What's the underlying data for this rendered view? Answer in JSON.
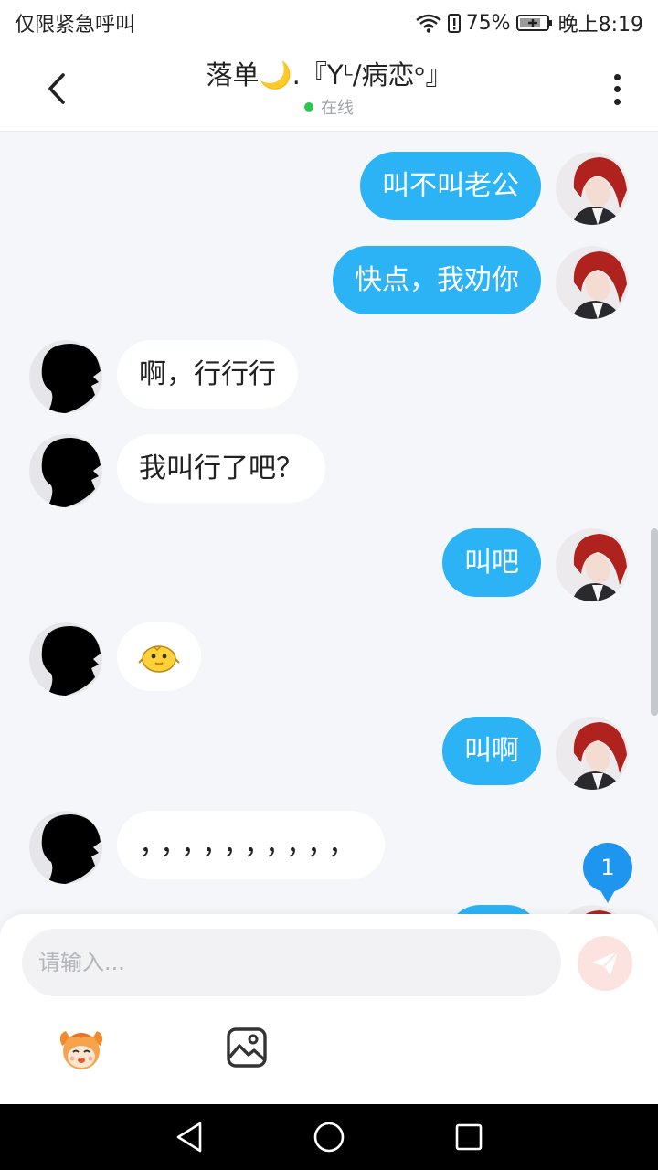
{
  "status_bar": {
    "carrier_text": "仅限紧急呼叫",
    "battery_percent": "75%",
    "time": "晚上8:19"
  },
  "header": {
    "title": "落单🌙.『Yᴸ/病恋ᵒ』",
    "status": "在线",
    "status_color": "#2bc84e"
  },
  "messages": [
    {
      "sender": "me",
      "text": "叫不叫老公"
    },
    {
      "sender": "me",
      "text": "快点，我劝你"
    },
    {
      "sender": "other",
      "text": "啊，行行行"
    },
    {
      "sender": "other",
      "text": "我叫行了吧？"
    },
    {
      "sender": "me",
      "text": "叫吧"
    },
    {
      "sender": "other",
      "text": "",
      "sticker": "yellow-chick-sticker"
    },
    {
      "sender": "me",
      "text": "叫啊"
    },
    {
      "sender": "other",
      "text": "，，，，，，，，，，"
    }
  ],
  "unread_count": "1",
  "composer": {
    "placeholder": "请输入..."
  },
  "icons": {
    "back": "chevron-left-icon",
    "more": "more-vertical-icon",
    "send": "paper-plane-icon",
    "emoji": "emoji-mascot-icon",
    "image": "image-icon"
  },
  "colors": {
    "outgoing_bubble": "#2bb3f5",
    "incoming_bubble": "#ffffff",
    "background": "#f4f6f9",
    "badge": "#1e96ef"
  }
}
